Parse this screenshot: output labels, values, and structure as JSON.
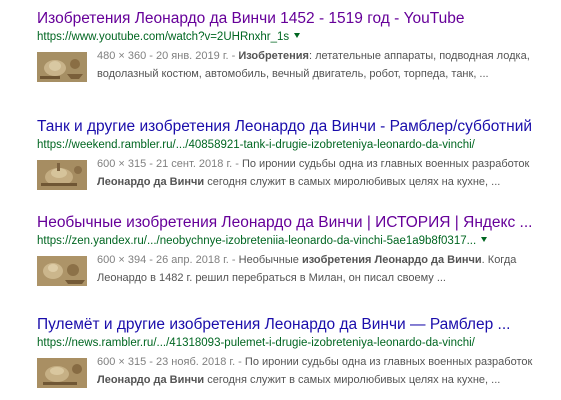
{
  "results": [
    {
      "title": "Изобретения Леонардо да Винчи 1452 - 1519 год - YouTube",
      "url": "https://www.youtube.com/watch?v=2UHRnxhr_1s",
      "has_caret": true,
      "meta": "480 × 360 - 20 янв. 2019 г. - ",
      "line1_rest": ": летательные аппараты, подводная лодка,",
      "line1_bold": "Изобретения",
      "line2": "водолазный костюм, автомобиль, вечный двигатель, робот, торпеда, танк, ..."
    },
    {
      "title": "Танк и другие изобретения Леонардо да Винчи - Рамблер/субботний",
      "url": "https://weekend.rambler.ru/.../40858921-tank-i-drugie-izobreteniya-leonardo-da-vinchi/",
      "meta": "600 × 315 - 21 сент. 2018 г. - ",
      "line1": "По иронии судьбы одна из главных военных разработок",
      "line2_bold": "Леонардо да Винчи",
      "line2_rest": " сегодня служит в самых миролюбивых целях на кухне, ..."
    },
    {
      "title": "Необычные изобретения Леонардо да Винчи | ИСТОРИЯ | Яндекс ...",
      "url": "https://zen.yandex.ru/.../neobychnye-izobreteniia-leonardo-da-vinchi-5ae1a9b8f0317...",
      "has_caret": true,
      "meta": "600 × 394 - 26 апр. 2018 г. - ",
      "line1_pre": "Необычные ",
      "line1_bold": "изобретения Леонардо да Винчи",
      "line1_post": ". Когда",
      "line2": "Леонардо в 1482 г. решил перебраться в Милан, он писал своему ..."
    },
    {
      "title": "Пулемёт и другие изобретения Леонардо да Винчи — Рамблер ...",
      "url": "https://news.rambler.ru/.../41318093-pulemet-i-drugie-izobreteniya-leonardo-da-vinchi/",
      "meta": "600 × 315 - 23 нояб. 2018 г. - ",
      "line1": "По иронии судьбы одна из главных военных разработок",
      "line2_bold": "Леонардо да Винчи",
      "line2_rest": " сегодня служит в самых миролюбивых целях на кухне, ..."
    }
  ],
  "colors": {
    "title_visited": "#660099",
    "title_unvisited": "#1a0dab",
    "url": "#006621",
    "snippet": "#545454",
    "meta": "#808080"
  },
  "icons": [
    "dropdown-caret-icon",
    "thumbnail-image"
  ]
}
